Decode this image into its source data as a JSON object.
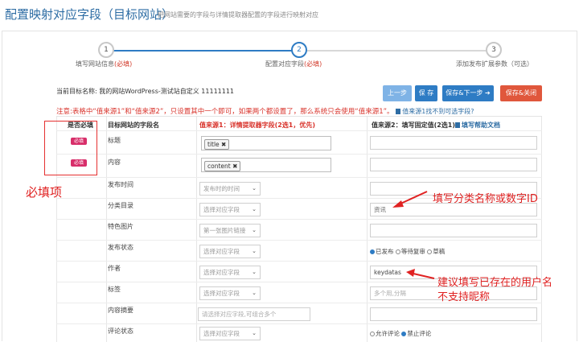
{
  "header": {
    "title": "配置映射对应字段（目标网站）",
    "subtitle": "把网站需要的字段与详情提取器配置的字段进行映射对应"
  },
  "steps": [
    {
      "num": "1",
      "label": "填写网站信息",
      "req": "(必填)"
    },
    {
      "num": "2",
      "label": "配置对应字段",
      "req": "(必填)"
    },
    {
      "num": "3",
      "label": "添加发布扩展参数（可选）",
      "req": ""
    }
  ],
  "target": {
    "label": "当前目标名称:",
    "value": "我的网站WordPress-测试站自定义 11111111"
  },
  "buttons": {
    "prev": "上一步",
    "save": "保 存",
    "save_next": "保存&下一步 ➔",
    "save_close": "保存&关闭"
  },
  "note": {
    "text": "注意:表格中“值来源1”和“值来源2”，只设置其中一个即可，如果两个都设置了，那么系统只会使用“值来源1”。",
    "link": "值来源1找不到可选字段?"
  },
  "table_headers": {
    "required": "是否必填",
    "field": "目标网站的字段名",
    "source1": "值来源1：详情提取器字段(2选1，优先)",
    "source2": "值来源2：填写固定值(2选1)",
    "help": "填写帮助文档"
  },
  "badge_text": "必填",
  "rows": [
    {
      "name": "标题",
      "required": true,
      "tag": "title"
    },
    {
      "name": "内容",
      "required": true,
      "tag": "content"
    },
    {
      "name": "发布时间",
      "select": "发布时的时间",
      "value": ""
    },
    {
      "name": "分类目录",
      "select": "选择对应字段",
      "value": "资讯"
    },
    {
      "name": "特色图片",
      "select": "第一张图片链接",
      "value": ""
    },
    {
      "name": "发布状态",
      "select": "选择对应字段",
      "radios": [
        "已发布",
        "等待复审",
        "草稿"
      ]
    },
    {
      "name": "作者",
      "select": "选择对应字段",
      "value": "keydatas"
    },
    {
      "name": "标签",
      "select": "选择对应字段",
      "placeholder": "多个用,分隔"
    },
    {
      "name": "内容摘要",
      "input_placeholder": "请选择对应字段,可组合多个",
      "value": ""
    },
    {
      "name": "评论状态",
      "select": "选择对应字段",
      "radios": [
        "允许评论",
        "禁止评论"
      ]
    }
  ],
  "annotations": {
    "required_label": "必填项",
    "category_tip": "填写分类名称或数字ID",
    "author_tip_line1": "建议填写已存在的用户名",
    "author_tip_line2": "不支持昵称"
  },
  "colors": {
    "accent": "#2e7cc4",
    "danger": "#d8322a",
    "badge": "#d82e6a",
    "close_btn": "#e0573c",
    "prev_btn": "#7fb3e6"
  }
}
